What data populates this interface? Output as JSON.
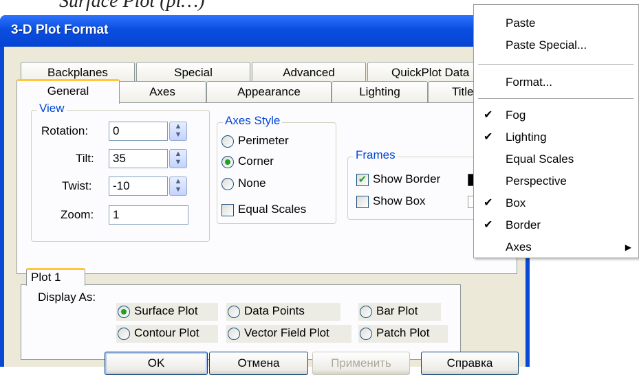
{
  "background_text": "Surface Plot (pi…)",
  "dialog": {
    "title": "3-D Plot Format",
    "tabs_back": [
      "Backplanes",
      "Special",
      "Advanced",
      "QuickPlot Data"
    ],
    "tabs_front": [
      "General",
      "Axes",
      "Appearance",
      "Lighting",
      "Title"
    ],
    "active_tab": "General",
    "view": {
      "legend": "View",
      "rotation_label": "Rotation:",
      "rotation_value": "0",
      "tilt_label": "Tilt:",
      "tilt_value": "35",
      "twist_label": "Twist:",
      "twist_value": "-10",
      "zoom_label": "Zoom:",
      "zoom_value": "1"
    },
    "axes_style": {
      "legend": "Axes Style",
      "options": [
        "Perimeter",
        "Corner",
        "None"
      ],
      "selected": "Corner",
      "equal_scales_label": "Equal Scales",
      "equal_scales_checked": false
    },
    "frames": {
      "legend": "Frames",
      "show_border_label": "Show Border",
      "show_border_checked": true,
      "show_box_label": "Show Box",
      "show_box_checked": false
    },
    "plot": {
      "tab_label": "Plot 1",
      "display_as_label": "Display As:",
      "options": [
        "Surface Plot",
        "Data Points",
        "Bar Plot",
        "Contour Plot",
        "Vector Field Plot",
        "Patch Plot"
      ],
      "selected": "Surface Plot"
    },
    "buttons": {
      "ok": "OK",
      "cancel": "Отмена",
      "apply": "Применить",
      "help": "Справка"
    }
  },
  "context_menu": {
    "items": [
      {
        "label": "Paste",
        "checked": false
      },
      {
        "label": "Paste Special...",
        "checked": false
      },
      {
        "label": "Format...",
        "checked": false
      },
      {
        "label": "Fog",
        "checked": true
      },
      {
        "label": "Lighting",
        "checked": true
      },
      {
        "label": "Equal Scales",
        "checked": false
      },
      {
        "label": "Perspective",
        "checked": false
      },
      {
        "label": "Box",
        "checked": true
      },
      {
        "label": "Border",
        "checked": true
      },
      {
        "label": "Axes",
        "checked": false,
        "submenu": true
      }
    ]
  },
  "colors": {
    "titlebar": "#0a4ee0",
    "legend_text": "#0046d5",
    "active_tab_accent": "#ffc83c",
    "radio_dot": "#21a121",
    "dialog_bg": "#ece9d8"
  }
}
